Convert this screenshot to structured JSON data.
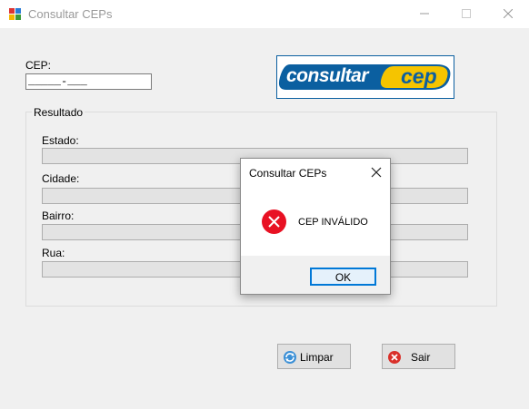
{
  "window": {
    "title": "Consultar CEPs"
  },
  "form": {
    "cep_label": "CEP:",
    "cep_value": "_____-___",
    "logo_text_left": "consultar",
    "logo_text_right": "cep",
    "group_title": "Resultado",
    "fields": [
      {
        "label": "Estado:",
        "value": ""
      },
      {
        "label": "Cidade:",
        "value": ""
      },
      {
        "label": "Bairro:",
        "value": ""
      },
      {
        "label": "Rua:",
        "value": ""
      }
    ],
    "limpar_label": "Limpar",
    "sair_label": "Sair"
  },
  "dialog": {
    "title": "Consultar CEPs",
    "message": "CEP INVÁLIDO",
    "ok_label": "OK"
  },
  "colors": {
    "logo_blue": "#0b5fa0",
    "logo_yellow": "#f5c400",
    "error_red": "#e81123",
    "focus_blue": "#0078d7"
  }
}
